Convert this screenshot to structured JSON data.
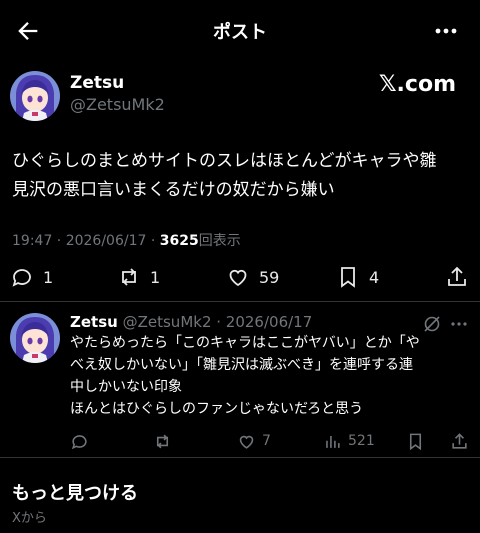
{
  "header": {
    "title": "ポスト"
  },
  "post": {
    "author_name": "Zetsu",
    "author_handle": "@ZetsuMk2",
    "brand": "𝕏.com",
    "text_line1": "ひぐらしのまとめサイトのスレはほとんどがキャラや雛",
    "text_line2": "見沢の悪口言いまくるだけの奴だから嫌い",
    "meta_time": "19:47 · 2026/06/17 · ",
    "views_count": "3625",
    "views_label": "回表示",
    "actions": {
      "reply": "1",
      "repost": "1",
      "like": "59",
      "bookmark": "4"
    }
  },
  "reply": {
    "author_name": "Zetsu",
    "sub": "@ZetsuMk2 · 2026/06/17",
    "lines": [
      "やたらめったら「このキャラはここがヤバい」とか「や",
      "べえ奴しかいない」「雛見沢は滅ぶべき」を連呼する連",
      "中しかいない印象",
      "ほんとはひぐらしのファンじゃないだろと思う"
    ],
    "actions": {
      "like": "7",
      "views": "521"
    }
  },
  "discover": {
    "title": "もっと見つける",
    "sub": "Xから"
  },
  "colors": {
    "bg": "#000000",
    "text": "#e7e9ea",
    "muted": "#71767b",
    "divider": "#2f3336"
  },
  "icons": [
    "back-arrow-icon",
    "more-icon",
    "reply-icon",
    "repost-icon",
    "like-icon",
    "bookmark-icon",
    "share-icon",
    "views-icon",
    "grok-icon"
  ]
}
